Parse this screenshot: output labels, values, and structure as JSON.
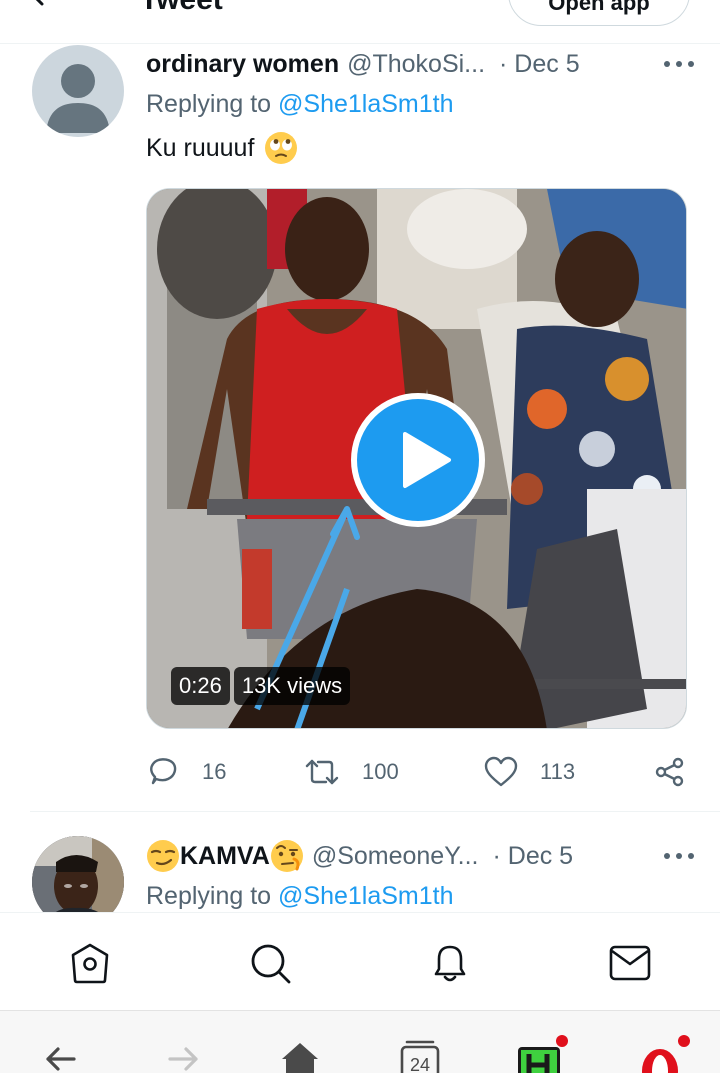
{
  "header": {
    "title": "Tweet",
    "open_app_label": "Open app"
  },
  "tweet1": {
    "display_name": "ordinary women",
    "handle": "@ThokoSi...",
    "date": "· Dec 5",
    "replying_prefix": "Replying to",
    "replying_to": "@She1laSm1th",
    "text": "Ku ruuuuf",
    "emoji": "face-with-rolling-eyes",
    "video": {
      "duration": "0:26",
      "views": "13K views"
    },
    "actions": {
      "replies": "16",
      "retweets": "100",
      "likes": "113"
    }
  },
  "tweet2": {
    "display_name": "KAMVA",
    "handle": "@SomeoneY...",
    "date": "· Dec 5",
    "replying_prefix": "Replying to",
    "replying_to": "@She1laSm1th",
    "emoji_left": "smirking-face",
    "emoji_right": "face-with-raised-eyebrow"
  },
  "tabbar": {
    "icons": [
      "home-icon",
      "search-icon",
      "notifications-icon",
      "messages-icon"
    ]
  },
  "browser": {
    "tab_count": "24",
    "icons": [
      "back-icon",
      "forward-icon",
      "home-icon",
      "tabs-icon",
      "h-app-icon",
      "opera-icon"
    ]
  },
  "colors": {
    "accent": "#1d9bf0",
    "text": "#0f1419",
    "secondary_text": "#536471",
    "notification_dot": "#e0101c"
  }
}
